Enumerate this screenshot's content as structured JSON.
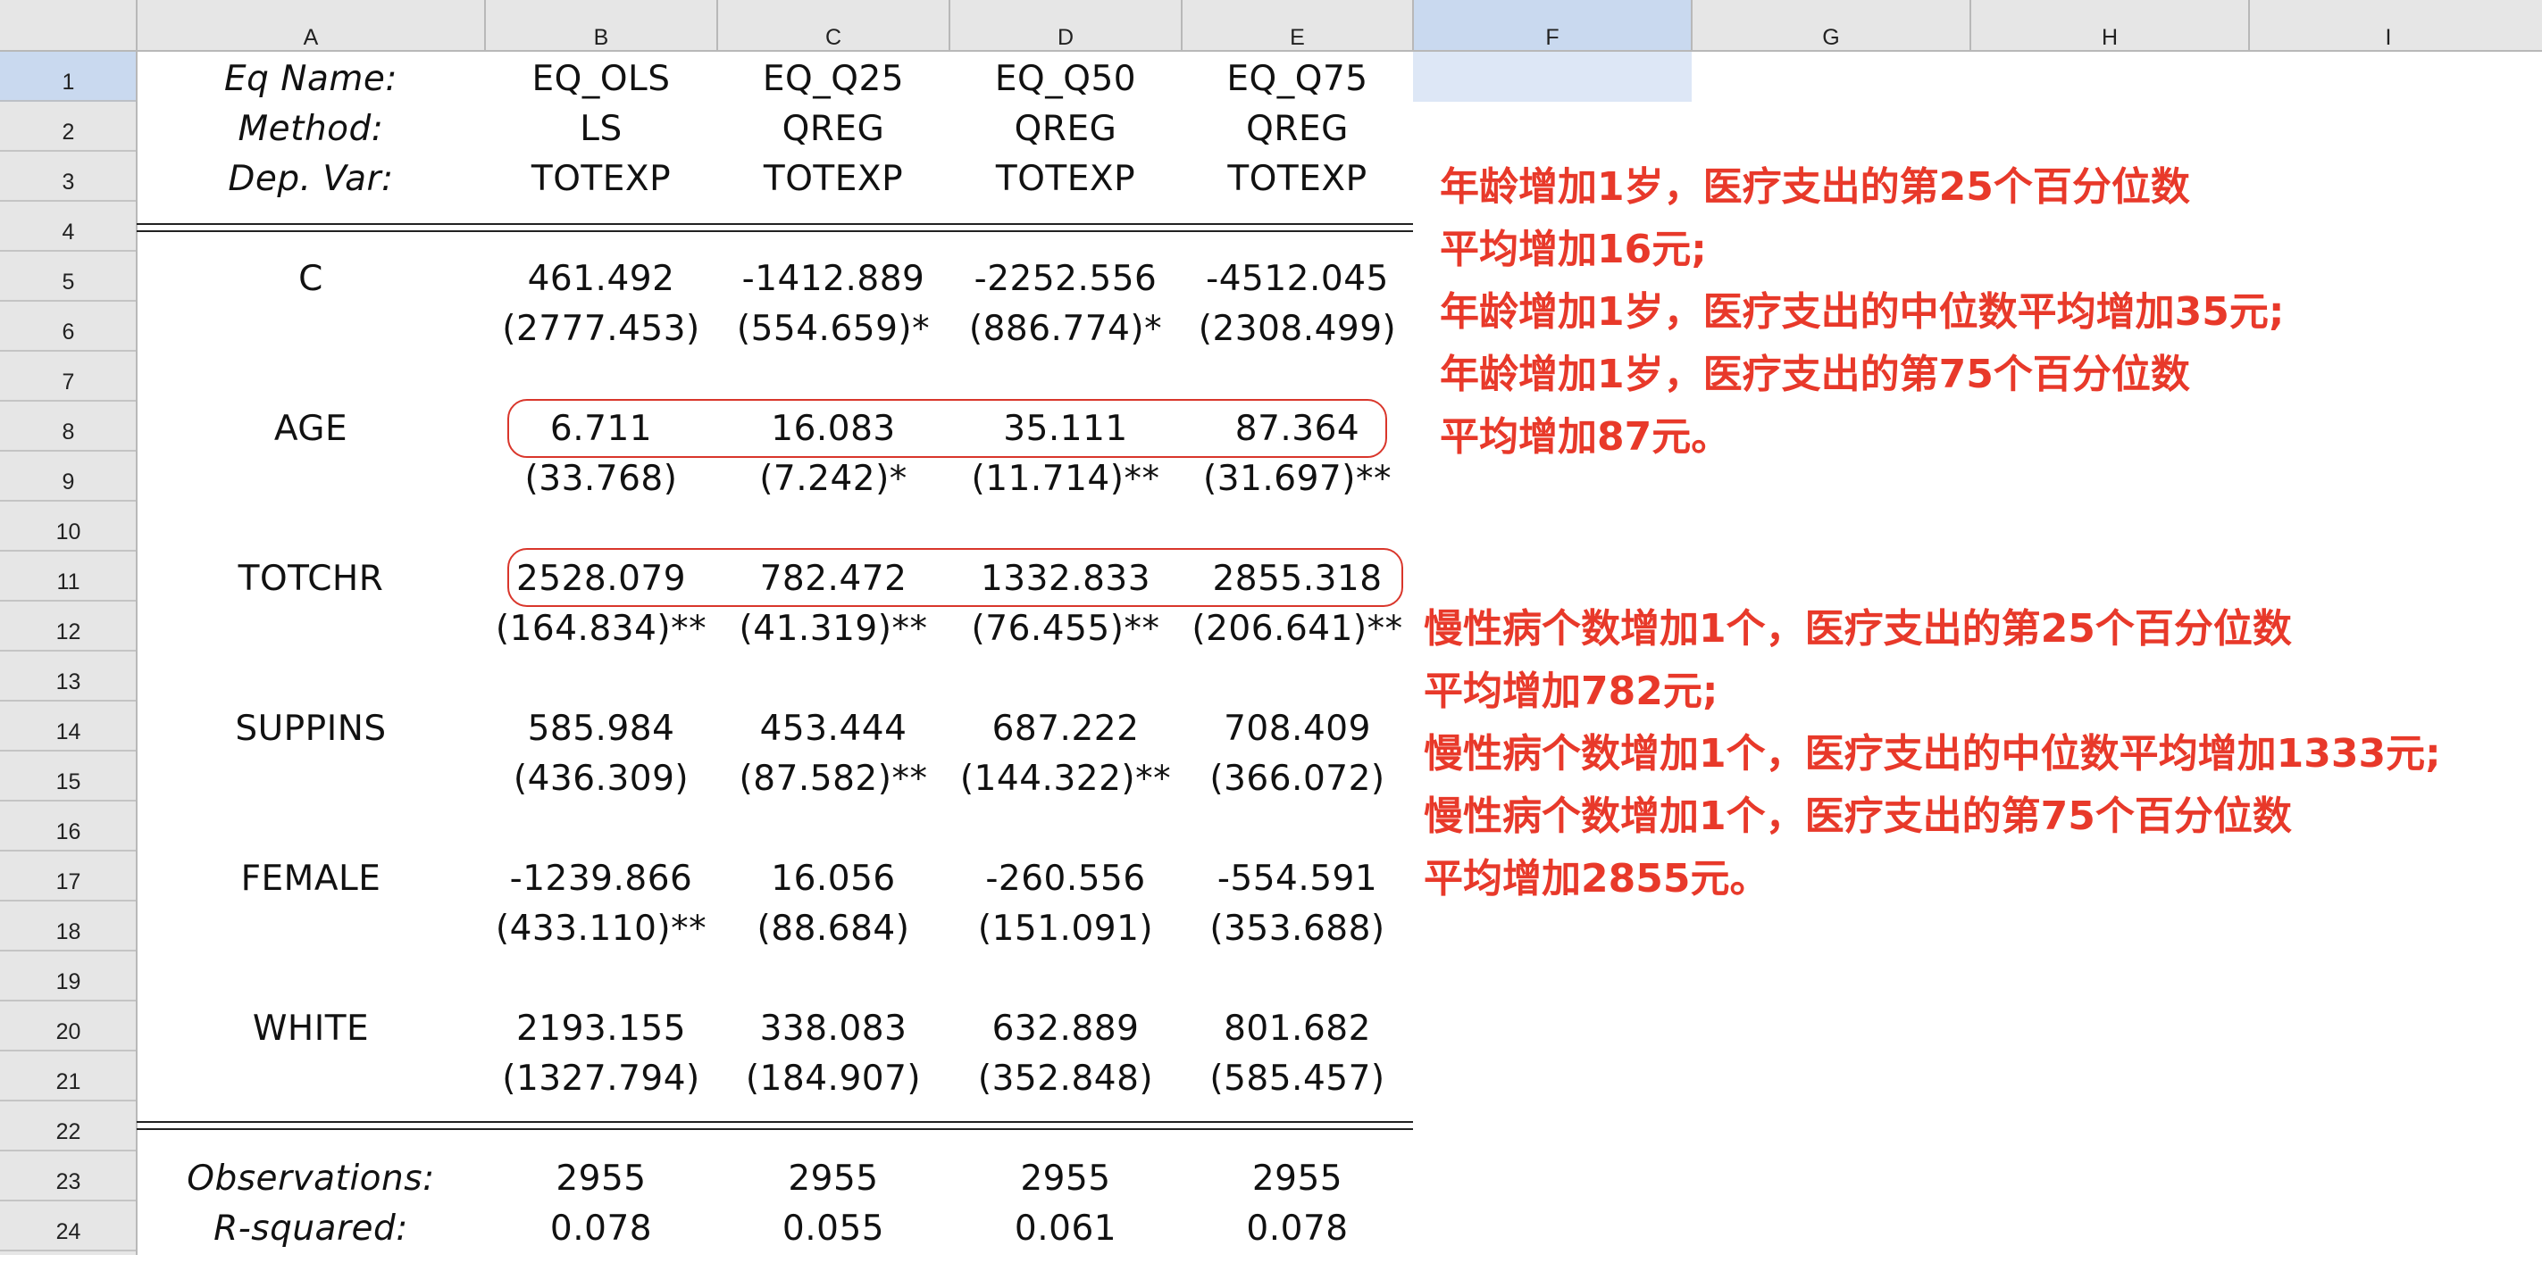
{
  "columns": [
    "A",
    "B",
    "C",
    "D",
    "E",
    "F",
    "G",
    "H",
    "I"
  ],
  "rows": [
    "1",
    "2",
    "3",
    "4",
    "5",
    "6",
    "7",
    "8",
    "9",
    "10",
    "11",
    "12",
    "13",
    "14",
    "15",
    "16",
    "17",
    "18",
    "19",
    "20",
    "21",
    "22",
    "23",
    "24"
  ],
  "table": {
    "header": [
      [
        "Eq Name:",
        "EQ_OLS",
        "EQ_Q25",
        "EQ_Q50",
        "EQ_Q75"
      ],
      [
        "Method:",
        "LS",
        "QREG",
        "QREG",
        "QREG"
      ],
      [
        "Dep. Var:",
        "TOTEXP",
        "TOTEXP",
        "TOTEXP",
        "TOTEXP"
      ]
    ],
    "vars": [
      {
        "name": "C",
        "coef": [
          "461.492",
          "-1412.889",
          "-2252.556",
          "-4512.045"
        ],
        "se": [
          "(2777.453)",
          "(554.659)*",
          "(886.774)*",
          "(2308.499)"
        ]
      },
      {
        "name": "AGE",
        "coef": [
          "6.711",
          "16.083",
          "35.111",
          "87.364"
        ],
        "se": [
          "(33.768)",
          "(7.242)*",
          "(11.714)**",
          "(31.697)**"
        ]
      },
      {
        "name": "TOTCHR",
        "coef": [
          "2528.079",
          "782.472",
          "1332.833",
          "2855.318"
        ],
        "se": [
          "(164.834)**",
          "(41.319)**",
          "(76.455)**",
          "(206.641)**"
        ]
      },
      {
        "name": "SUPPINS",
        "coef": [
          "585.984",
          "453.444",
          "687.222",
          "708.409"
        ],
        "se": [
          "(436.309)",
          "(87.582)**",
          "(144.322)**",
          "(366.072)"
        ]
      },
      {
        "name": "FEMALE",
        "coef": [
          "-1239.866",
          "16.056",
          "-260.556",
          "-554.591"
        ],
        "se": [
          "(433.110)**",
          "(88.684)",
          "(151.091)",
          "(353.688)"
        ]
      },
      {
        "name": "WHITE",
        "coef": [
          "2193.155",
          "338.083",
          "632.889",
          "801.682"
        ],
        "se": [
          "(1327.794)",
          "(184.907)",
          "(352.848)",
          "(585.457)"
        ]
      }
    ],
    "footer": [
      [
        "Observations:",
        "2955",
        "2955",
        "2955",
        "2955"
      ],
      [
        "R-squared:",
        "0.078",
        "0.055",
        "0.061",
        "0.078"
      ]
    ]
  },
  "notes_age": [
    "年龄增加1岁，医疗支出的第25个百分位数",
    "平均增加16元;",
    "年龄增加1岁，医疗支出的中位数平均增加35元;",
    "年龄增加1岁，医疗支出的第75个百分位数",
    "平均增加87元。"
  ],
  "notes_totchr": [
    "慢性病个数增加1个，医疗支出的第25个百分位数",
    "平均增加782元;",
    "慢性病个数增加1个，医疗支出的中位数平均增加1333元;",
    "慢性病个数增加1个，医疗支出的第75个百分位数",
    "平均增加2855元。"
  ],
  "colors": {
    "annotation": "#e8392a",
    "highlight_box": "#d9362b",
    "selected_header": "#c9d9ef",
    "selected_cell": "#dde7f6",
    "header_bg": "#e4e4e4"
  }
}
